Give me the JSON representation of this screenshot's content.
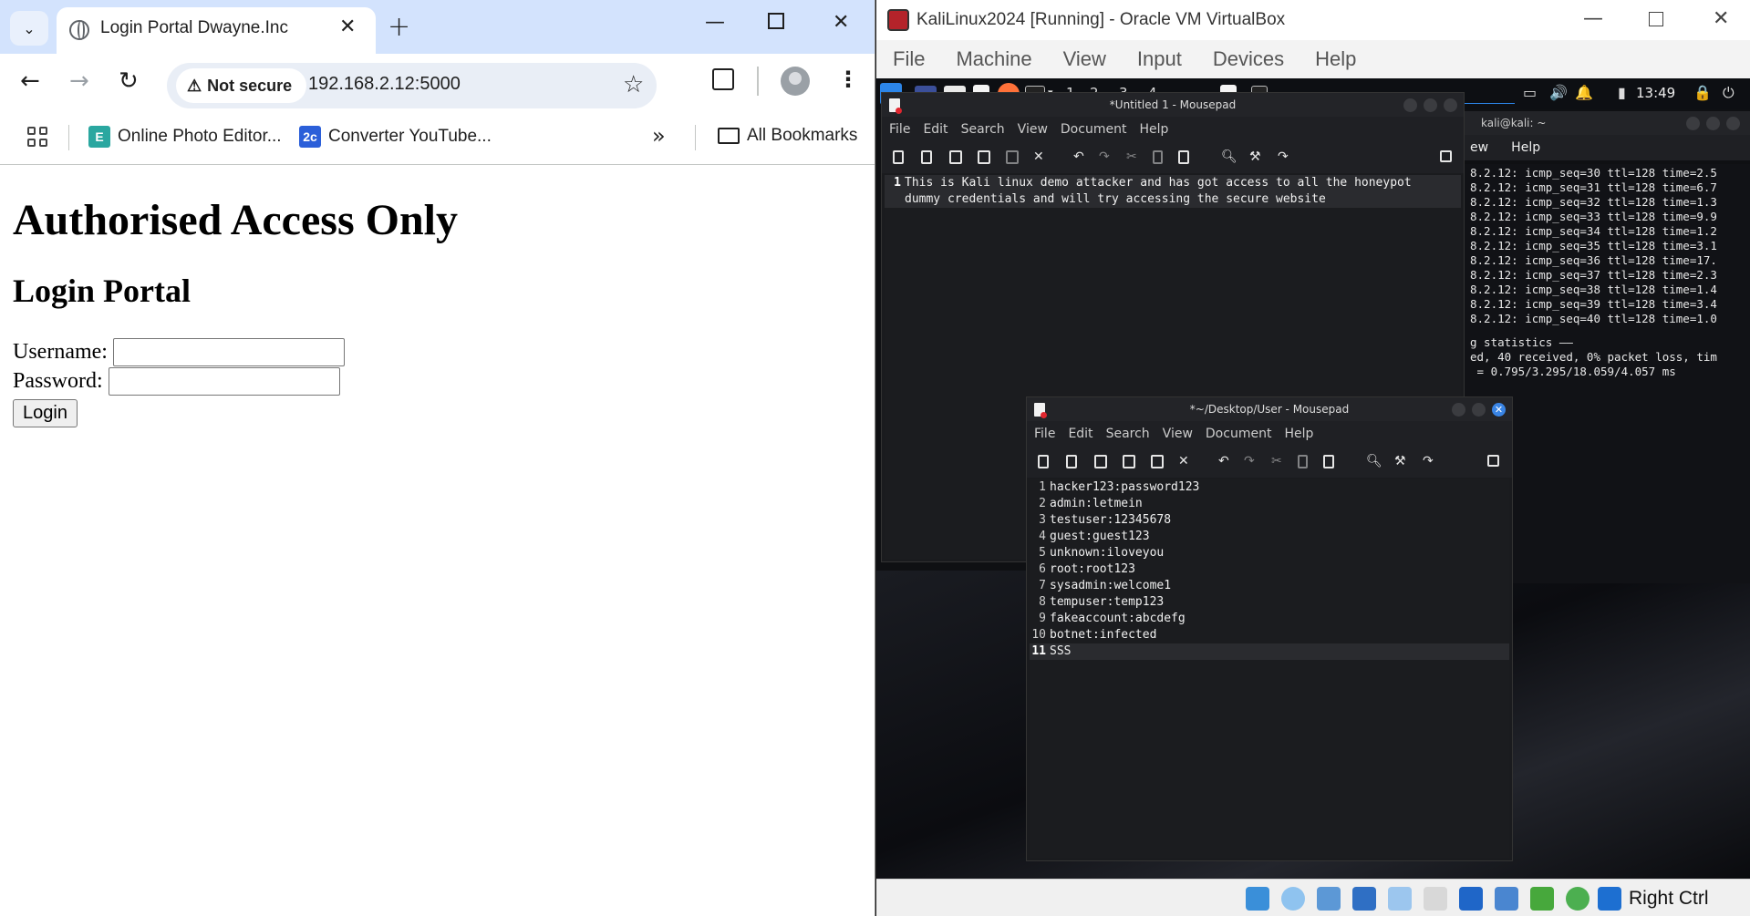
{
  "chrome": {
    "tab_title": "Login Portal Dwayne.Inc",
    "security_label": "Not secure",
    "url": "192.168.2.12:5000",
    "bookmarks": [
      {
        "label": "Online Photo Editor...",
        "icon_text": "E",
        "icon_color": "#2aa7a0"
      },
      {
        "label": "Converter YouTube...",
        "icon_text": "2c",
        "icon_color": "#2b5fd9"
      }
    ],
    "all_bookmarks_label": "All Bookmarks",
    "page": {
      "heading": "Authorised Access Only",
      "subheading": "Login Portal",
      "username_label": "Username:",
      "password_label": "Password:",
      "login_button": "Login",
      "username_value": "",
      "password_value": ""
    }
  },
  "vbox": {
    "title": "KaliLinux2024 [Running] - Oracle VM VirtualBox",
    "menu": [
      "File",
      "Machine",
      "View",
      "Input",
      "Devices",
      "Help"
    ],
    "host_key": "Right Ctrl",
    "guest": {
      "workspaces": [
        "1",
        "2",
        "3",
        "4"
      ],
      "clock": "13:49",
      "mousepad_back": {
        "title": "*Untitled 1 - Mousepad",
        "menu": [
          "File",
          "Edit",
          "Search",
          "View",
          "Document",
          "Help"
        ],
        "lines": [
          {
            "num": "1",
            "text": "This is Kali linux demo attacker and has got access to all the honeypot"
          },
          {
            "num": "",
            "text": "dummy credentials and will try accessing the secure website"
          }
        ]
      },
      "terminal": {
        "title": "kali@kali: ~",
        "menu": [
          "ew",
          "Help"
        ],
        "lines": [
          "8.2.12: icmp_seq=30 ttl=128 time=2.5",
          "8.2.12: icmp_seq=31 ttl=128 time=6.7",
          "8.2.12: icmp_seq=32 ttl=128 time=1.3",
          "8.2.12: icmp_seq=33 ttl=128 time=9.9",
          "8.2.12: icmp_seq=34 ttl=128 time=1.2",
          "8.2.12: icmp_seq=35 ttl=128 time=3.1",
          "8.2.12: icmp_seq=36 ttl=128 time=17.",
          "8.2.12: icmp_seq=37 ttl=128 time=2.3",
          "8.2.12: icmp_seq=38 ttl=128 time=1.4",
          "8.2.12: icmp_seq=39 ttl=128 time=3.4",
          "8.2.12: icmp_seq=40 ttl=128 time=1.0",
          "",
          "g statistics ——",
          "ed, 40 received, 0% packet loss, tim",
          " = 0.795/3.295/18.059/4.057 ms"
        ]
      },
      "mousepad_front": {
        "title": "*~/Desktop/User - Mousepad",
        "menu": [
          "File",
          "Edit",
          "Search",
          "View",
          "Document",
          "Help"
        ],
        "lines": [
          {
            "num": "1",
            "text": "hacker123:password123"
          },
          {
            "num": "2",
            "text": "admin:letmein"
          },
          {
            "num": "3",
            "text": "testuser:12345678"
          },
          {
            "num": "4",
            "text": "guest:guest123"
          },
          {
            "num": "5",
            "text": "unknown:iloveyou"
          },
          {
            "num": "6",
            "text": "root:root123"
          },
          {
            "num": "7",
            "text": "sysadmin:welcome1"
          },
          {
            "num": "8",
            "text": "tempuser:temp123"
          },
          {
            "num": "9",
            "text": "fakeaccount:abcdefg"
          },
          {
            "num": "10",
            "text": "botnet:infected"
          },
          {
            "num": "11",
            "text": "SSS"
          }
        ]
      }
    }
  }
}
